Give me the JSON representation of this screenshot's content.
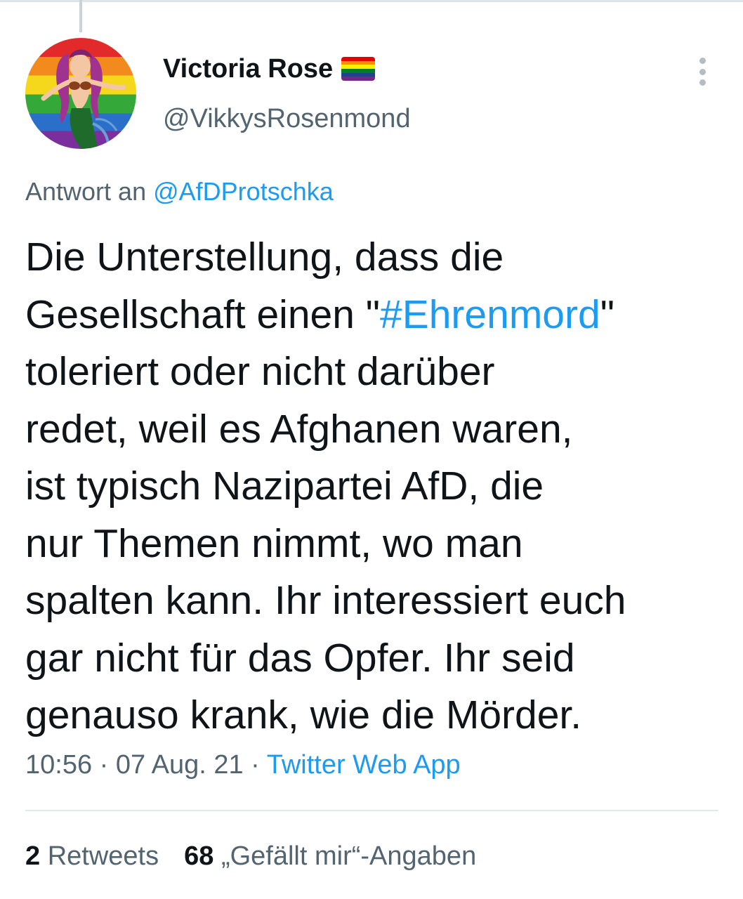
{
  "author": {
    "name": "Victoria Rose",
    "handle": "@VikkysRosenmond",
    "flag_icon": "rainbow-flag-icon",
    "flag_colors": [
      "#e40303",
      "#ff8c00",
      "#ffed00",
      "#008026",
      "#24408e",
      "#732982"
    ]
  },
  "reply": {
    "prefix": "Antwort an",
    "to": "@AfDProtschka"
  },
  "tweet": {
    "lines": [
      {
        "before": "Die Unterstellung, dass die"
      },
      {
        "before": "Gesellschaft einen \"",
        "hashtag": "#Ehrenmord",
        "after": "\""
      },
      {
        "before": "toleriert oder nicht darüber"
      },
      {
        "before": "redet, weil es Afghanen waren,"
      },
      {
        "before": "ist typisch Nazipartei AfD, die"
      },
      {
        "before": "nur Themen nimmt, wo man"
      },
      {
        "before": "spalten kann. Ihr interessiert euch"
      },
      {
        "before": "gar nicht für das Opfer. Ihr seid"
      },
      {
        "before": "genauso krank, wie die Mörder."
      }
    ]
  },
  "meta": {
    "time": "10:56",
    "separator": " · ",
    "date": "07 Aug. 21",
    "source": "Twitter Web App"
  },
  "stats": {
    "retweets_count": "2",
    "retweets_label": "Retweets",
    "likes_count": "68",
    "likes_label": "„Gefällt mir“-Angaben"
  },
  "colors": {
    "link": "#1d9bf0",
    "secondary_text": "#536471",
    "primary_text": "#0f1419"
  }
}
